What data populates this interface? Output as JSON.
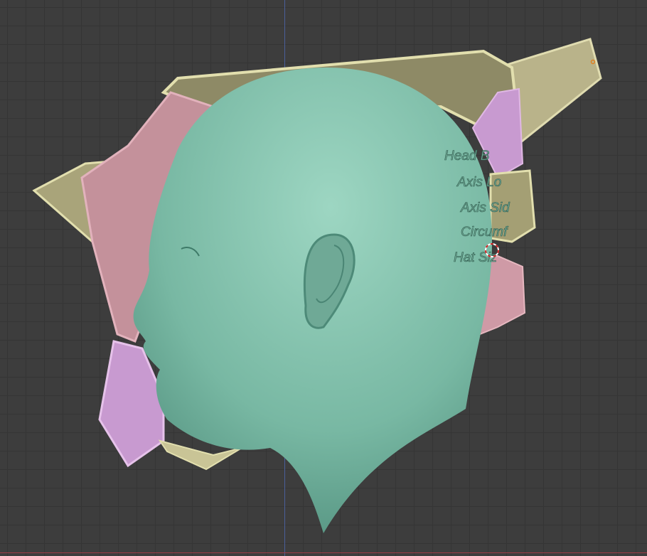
{
  "viewport": {
    "type": "3d-viewport",
    "model": "head-with-hat-shell",
    "colors": {
      "background": "#3d3d3d",
      "head": "#7dbca8",
      "shell_pink": "#cf9aa6",
      "shell_tan": "#c9c496",
      "shell_purple": "#c89ad0",
      "x_axis": "#a03c46",
      "z_axis": "#4a5f9a"
    }
  },
  "embossed_labels": [
    "Head B",
    "Axis Lo",
    "Axis Sid",
    "Circumf",
    "Hat Siz"
  ]
}
